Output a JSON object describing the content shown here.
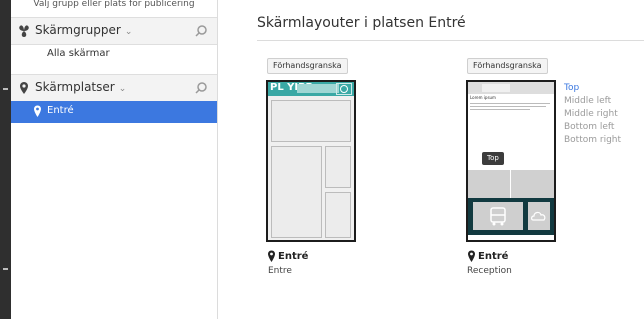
{
  "sidebar": {
    "publish_hint": "Välj grupp eller plats för publicering",
    "screen_groups": {
      "label": "Skärmgrupper",
      "items": [
        "Alla skärmar"
      ]
    },
    "screen_locations": {
      "label": "Skärmplatser",
      "items": [
        {
          "label": "Entré",
          "selected": true
        }
      ]
    }
  },
  "main": {
    "title": "Skärmlayouter i platsen Entré",
    "cards": [
      {
        "preview_label": "Förhandsgranska",
        "thumbnail_logo": "PL YIPP",
        "name": "Entré",
        "layout": "Entre"
      },
      {
        "preview_label": "Förhandsgranska",
        "thumbnail_heading": "Lorem ipsum",
        "tooltip": "Top",
        "name": "Entré",
        "layout": "Reception",
        "regions": [
          "Top",
          "Middle left",
          "Middle right",
          "Bottom left",
          "Bottom right"
        ],
        "active_region": "Top"
      }
    ]
  },
  "colors": {
    "accent_blue": "#3c78e0",
    "teal_header": "#3aa8a5",
    "dark_panel": "#123a40",
    "left_rail": "#2f2f2f"
  },
  "icons": [
    "screen-groups-icon",
    "location-pin-icon",
    "search-icon",
    "chevron-down-icon"
  ]
}
